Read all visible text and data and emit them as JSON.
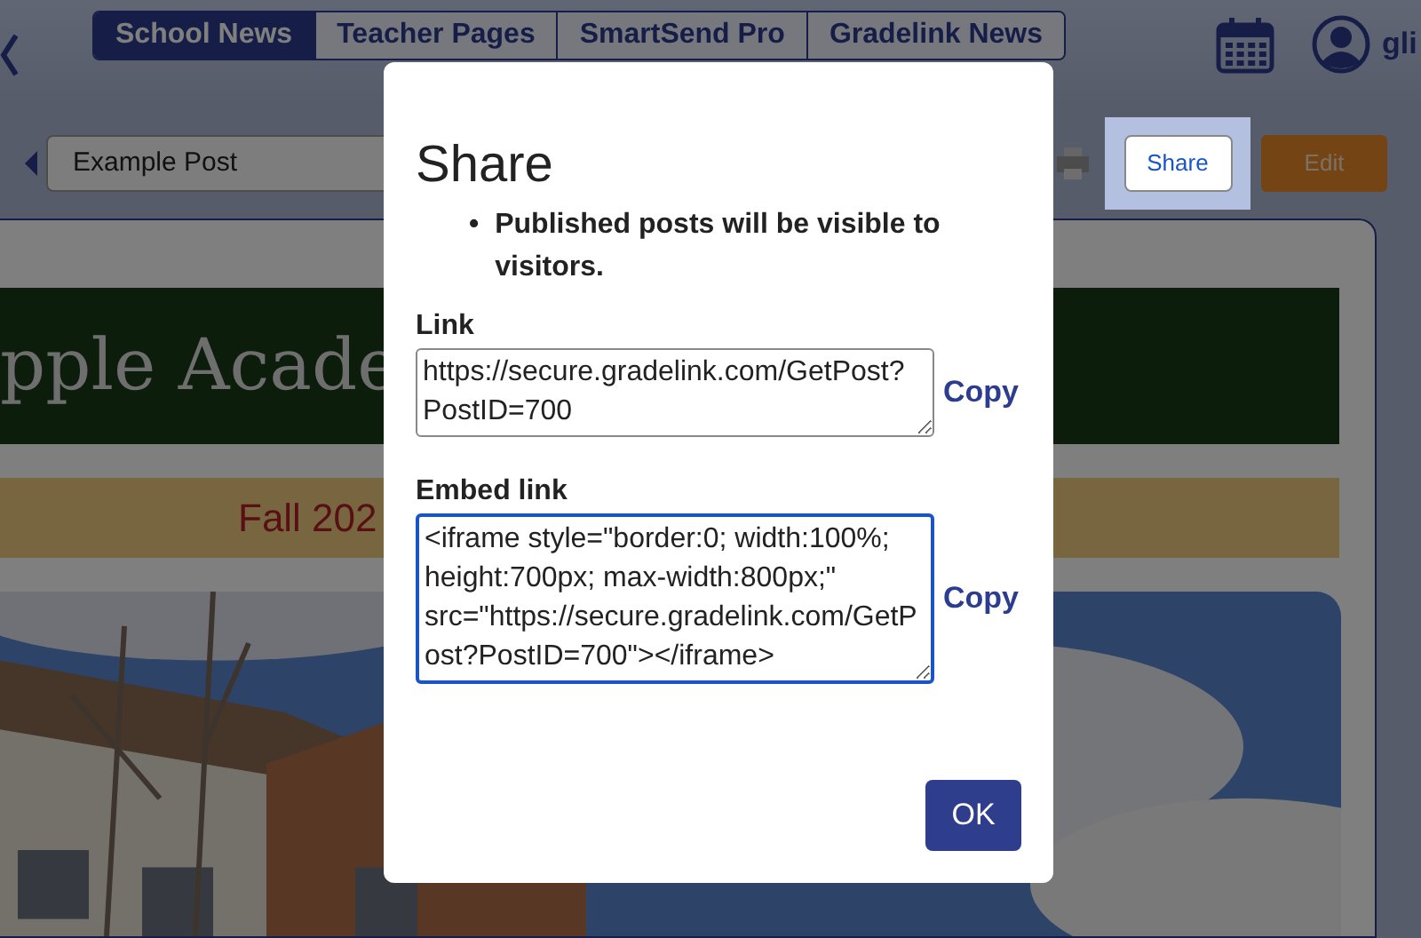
{
  "header": {
    "tabs": [
      {
        "label": "School News",
        "selected": true
      },
      {
        "label": "Teacher Pages",
        "selected": false
      },
      {
        "label": "SmartSend Pro",
        "selected": false
      },
      {
        "label": "Gradelink News",
        "selected": false
      }
    ],
    "user": "gli"
  },
  "toolbar": {
    "post_title": "Example Post",
    "share_button": {
      "label": "Share",
      "highlighted": true
    },
    "edit_button": "Edit"
  },
  "post": {
    "school_name": "pple Acade",
    "term": "Fall 202"
  },
  "dialog": {
    "title": "Share",
    "notes": [
      {
        "marker": "•",
        "text": "Published posts will be visible to visitors."
      }
    ],
    "fields": [
      {
        "label": "Link",
        "value": "https://secure.gradelink.com/GetPost?PostID=700",
        "copy": "Copy",
        "focused": false
      },
      {
        "label": "Embed link",
        "value": "<iframe style=\"border:0; width:100%; height:700px; max-width:800px;\" src=\"https://secure.gradelink.com/GetPost?PostID=700\"></iframe>",
        "copy": "Copy",
        "focused": true
      }
    ],
    "ok_button": "OK"
  }
}
